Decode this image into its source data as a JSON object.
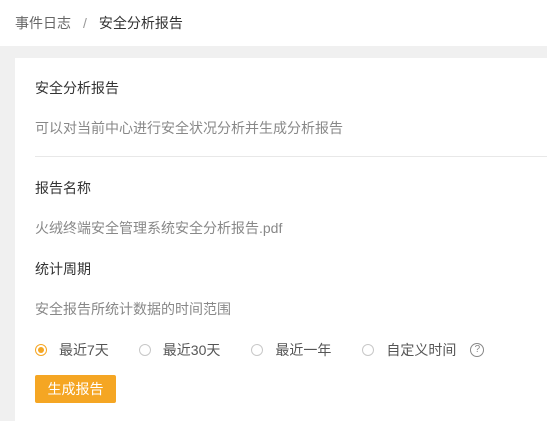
{
  "breadcrumb": {
    "parent": "事件日志",
    "separator": "/",
    "current": "安全分析报告"
  },
  "intro": {
    "title": "安全分析报告",
    "description": "可以对当前中心进行安全状况分析并生成分析报告"
  },
  "report_name": {
    "label": "报告名称",
    "value": "火绒终端安全管理系统安全分析报告.pdf"
  },
  "period": {
    "label": "统计周期",
    "description": "安全报告所统计数据的时间范围",
    "options": [
      "最近7天",
      "最近30天",
      "最近一年",
      "自定义时间"
    ],
    "selected": "最近7天",
    "help_icon": "?"
  },
  "actions": {
    "generate_label": "生成报告"
  },
  "colors": {
    "accent": "#f5a623"
  }
}
